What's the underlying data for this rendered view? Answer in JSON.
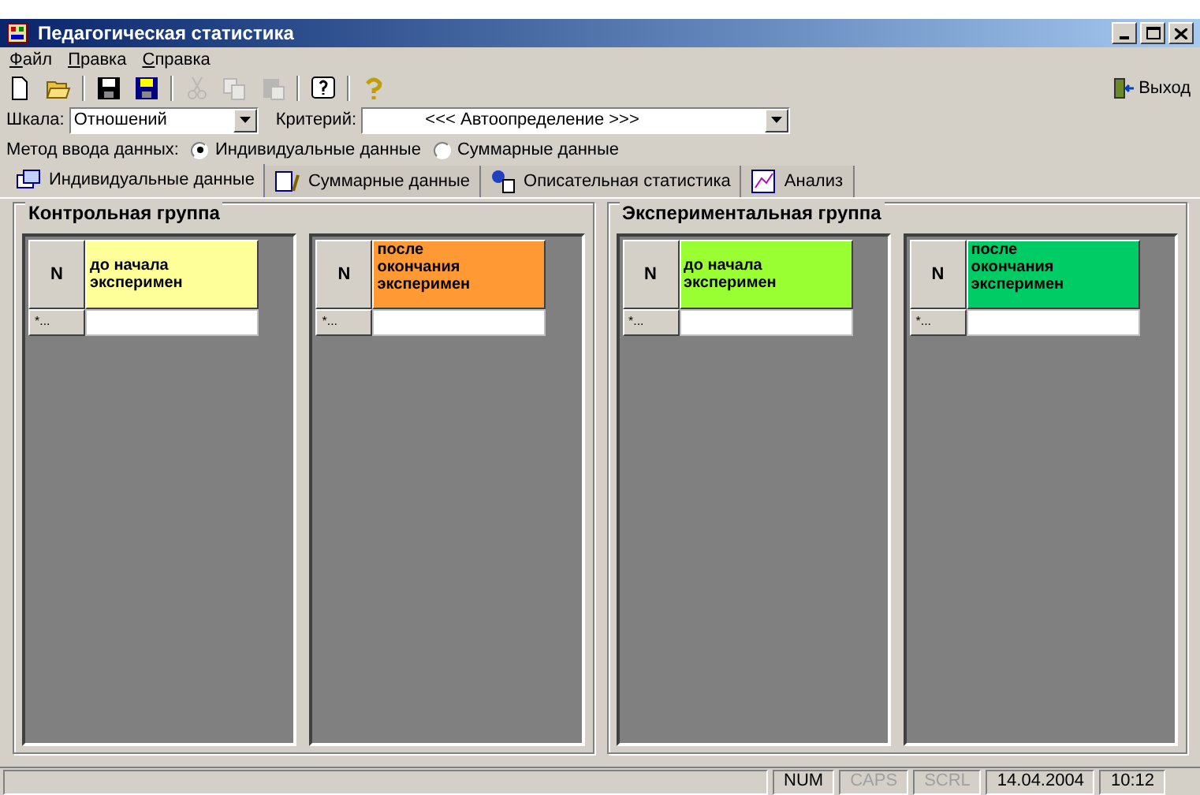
{
  "window": {
    "title": "Педагогическая статистика"
  },
  "menu": [
    {
      "label": "Файл"
    },
    {
      "label": "Правка"
    },
    {
      "label": "Справка"
    }
  ],
  "toolbar": {
    "buttons": [
      {
        "kind": "new",
        "disabled": false
      },
      {
        "kind": "open",
        "disabled": false
      },
      {
        "kind": "sep"
      },
      {
        "kind": "save",
        "disabled": false
      },
      {
        "kind": "saveas",
        "disabled": false
      },
      {
        "kind": "sep"
      },
      {
        "kind": "cut",
        "disabled": true
      },
      {
        "kind": "copy",
        "disabled": true
      },
      {
        "kind": "paste",
        "disabled": true
      },
      {
        "kind": "sep"
      },
      {
        "kind": "helpbox",
        "disabled": false
      },
      {
        "kind": "sep"
      },
      {
        "kind": "help",
        "disabled": false
      }
    ],
    "exit_label": "Выход"
  },
  "scale": {
    "label": "Шкала:",
    "value": "Отношений"
  },
  "criterion": {
    "label": "Критерий:",
    "value": "<<< Автоопределение >>>"
  },
  "input_method": {
    "label": "Метод ввода данных:",
    "options": [
      {
        "label": "Индивидуальные данные",
        "selected": true
      },
      {
        "label": "Суммарные данные",
        "selected": false
      }
    ]
  },
  "tabs": [
    {
      "label": "Индивидуальные данные",
      "selected": true
    },
    {
      "label": "Суммарные данные",
      "selected": false
    },
    {
      "label": "Описательная статистика",
      "selected": false
    },
    {
      "label": "Анализ",
      "selected": false
    }
  ],
  "groups": [
    {
      "title": "Контрольная группа",
      "grids": [
        {
          "n_header": "N",
          "header": "до начала\nэксперимен",
          "color": "#ffff99",
          "row_marker": "*..."
        },
        {
          "n_header": "N",
          "header": "после\nокончания\nэксперимен",
          "color": "#ff9933",
          "row_marker": "*..."
        }
      ]
    },
    {
      "title": "Экспериментальная группа",
      "grids": [
        {
          "n_header": "N",
          "header": "до начала\nэксперимен",
          "color": "#99ff33",
          "row_marker": "*..."
        },
        {
          "n_header": "N",
          "header": "после\nокончания\nэксперимен",
          "color": "#00cc66",
          "row_marker": "*..."
        }
      ]
    }
  ],
  "status_bar": [
    {
      "text": "NUM",
      "disabled": false
    },
    {
      "text": "CAPS",
      "disabled": true
    },
    {
      "text": "SCRL",
      "disabled": true
    },
    {
      "text": "14.04.2004",
      "disabled": false
    },
    {
      "text": "10:12",
      "disabled": false
    }
  ]
}
